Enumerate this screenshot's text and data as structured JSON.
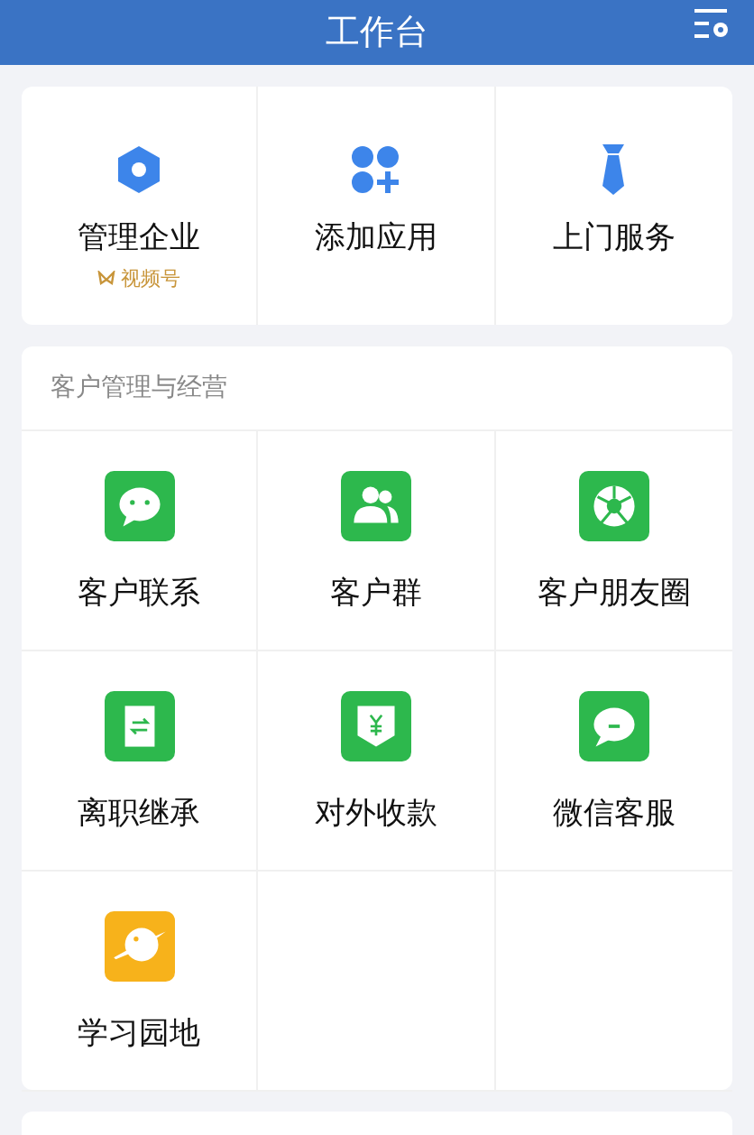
{
  "header": {
    "title": "工作台"
  },
  "top_apps": [
    {
      "label": "管理企业",
      "subtitle": "视频号"
    },
    {
      "label": "添加应用"
    },
    {
      "label": "上门服务"
    }
  ],
  "section": {
    "title": "客户管理与经营",
    "apps": [
      {
        "label": "客户联系",
        "color": "#2db84d"
      },
      {
        "label": "客户群",
        "color": "#2db84d"
      },
      {
        "label": "客户朋友圈",
        "color": "#2db84d"
      },
      {
        "label": "离职继承",
        "color": "#2db84d"
      },
      {
        "label": "对外收款",
        "color": "#2db84d"
      },
      {
        "label": "微信客服",
        "color": "#2db84d"
      },
      {
        "label": "学习园地",
        "color": "#f7b21b"
      }
    ]
  }
}
